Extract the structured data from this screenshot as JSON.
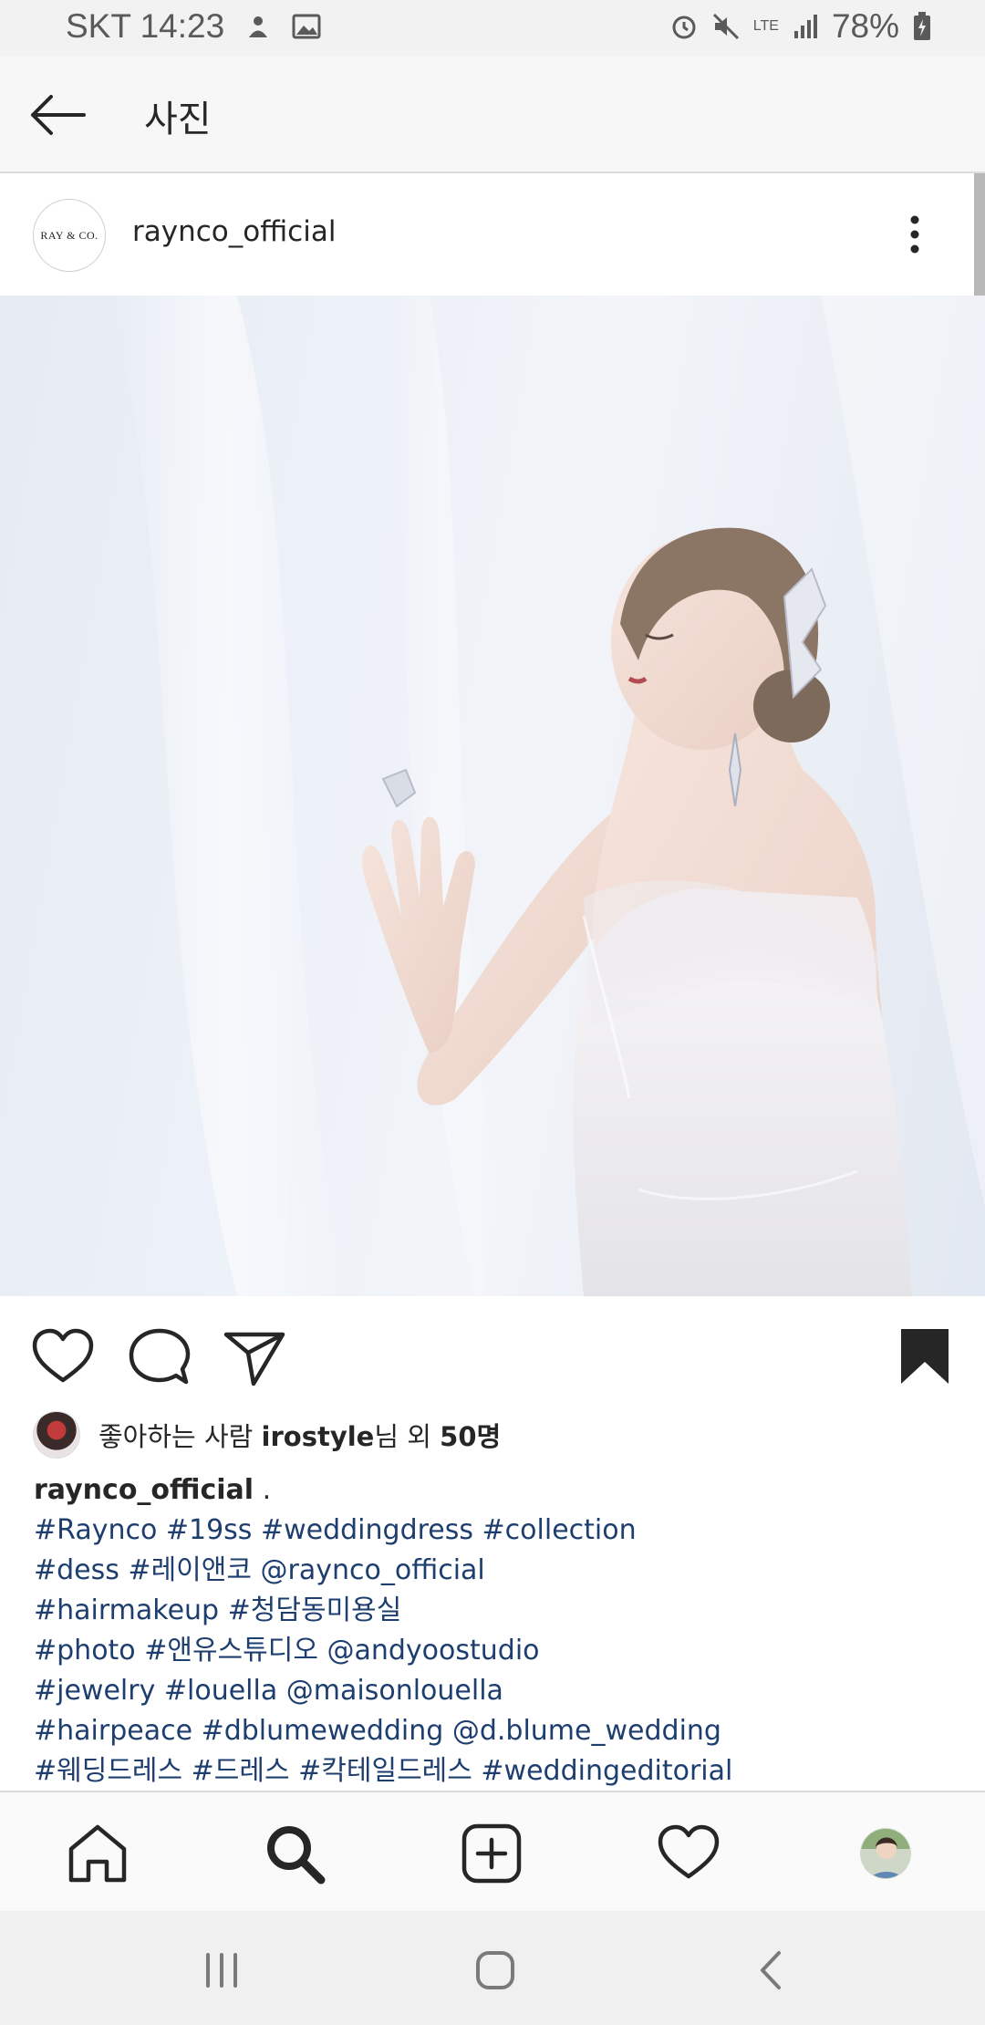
{
  "status_bar": {
    "carrier_time": "SKT 14:23",
    "network": "LTE",
    "battery": "78%"
  },
  "header": {
    "title": "사진"
  },
  "post": {
    "username": "raynco_official",
    "logo_text": "RAY & CO.",
    "likes": {
      "prefix": "좋아하는 사람 ",
      "user": "irostyle",
      "middle": "님 외 ",
      "count": "50명"
    },
    "caption": {
      "user": "raynco_official",
      "text": " .",
      "lines": [
        "#Raynco #19ss #weddingdress #collection",
        "#dess #레이앤코 @raynco_official",
        "#hairmakeup #청담동미용실",
        "#photo #앤유스튜디오 @andyoostudio",
        "#jewelry #louella @maisonlouella",
        "#hairpeace #dblumewedding @d.blume_wedding",
        "#웨딩드레스 #드레스 #칵테일드레스 #weddingeditorial"
      ]
    }
  },
  "colors": {
    "hashtag": "#1d3e6f",
    "text": "#262626",
    "status_bg": "#f2f2f2"
  },
  "icons": {
    "actions": [
      "heart-icon",
      "comment-icon",
      "share-icon",
      "bookmark-icon"
    ],
    "nav": [
      "home-icon",
      "search-icon",
      "add-post-icon",
      "activity-icon",
      "profile-avatar"
    ]
  }
}
